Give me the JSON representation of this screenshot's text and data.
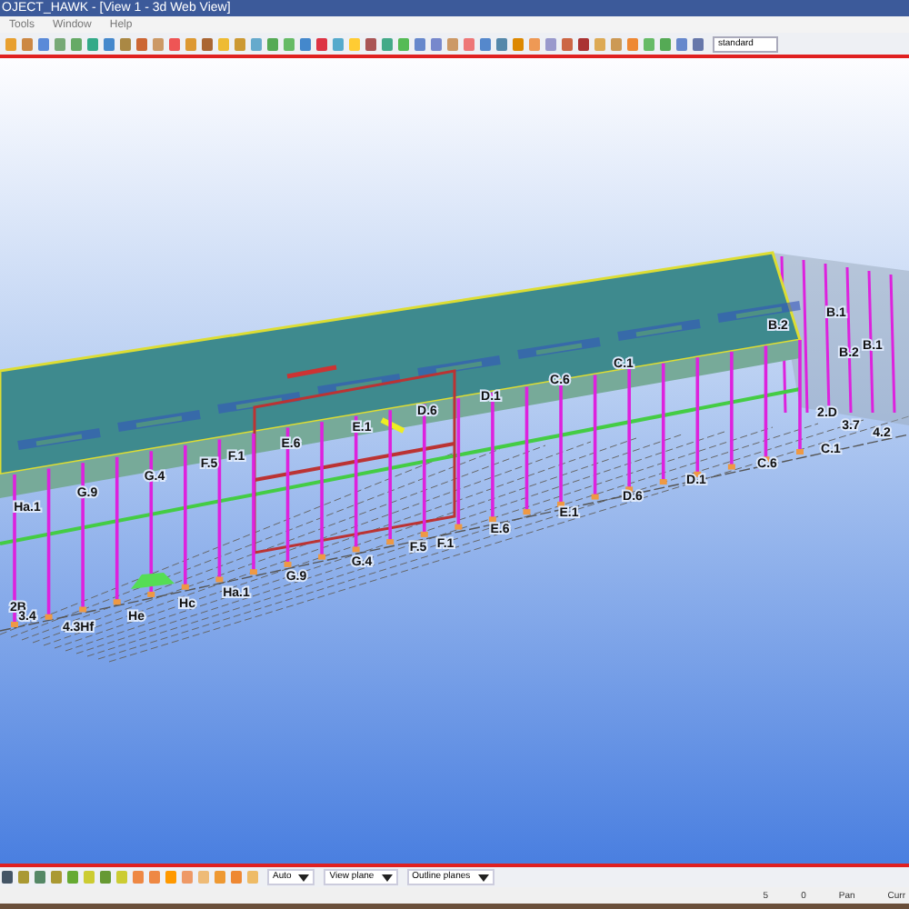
{
  "window": {
    "title": "OJECT_HAWK - [View 1 - 3d Web View]"
  },
  "menu": [
    {
      "label": "Tools"
    },
    {
      "label": "Window"
    },
    {
      "label": "Help"
    }
  ],
  "toolbar": {
    "combo": "standard"
  },
  "viewport": {
    "grid_labels": [
      "2B",
      "3.4",
      "4.3Hf",
      "He",
      "Hc",
      "Ha.1",
      "G.9",
      "G.4",
      "F.5",
      "F.1",
      "E.6",
      "E.1",
      "D.6",
      "D.1",
      "C.6",
      "2.D",
      "3.7",
      "4.2",
      "C.1",
      "Ha.1",
      "G.9",
      "G.4",
      "F.5",
      "F.1",
      "E.6",
      "E.1",
      "D.6",
      "D.1",
      "C.6",
      "C.1",
      "B.2",
      "B.1",
      "B.2",
      "B.1"
    ]
  },
  "bottom_toolbar": {
    "dropdowns": [
      "Auto",
      "View plane",
      "Outline planes"
    ]
  },
  "status_bar": [
    "5",
    "0",
    "Pan",
    "Curr"
  ]
}
